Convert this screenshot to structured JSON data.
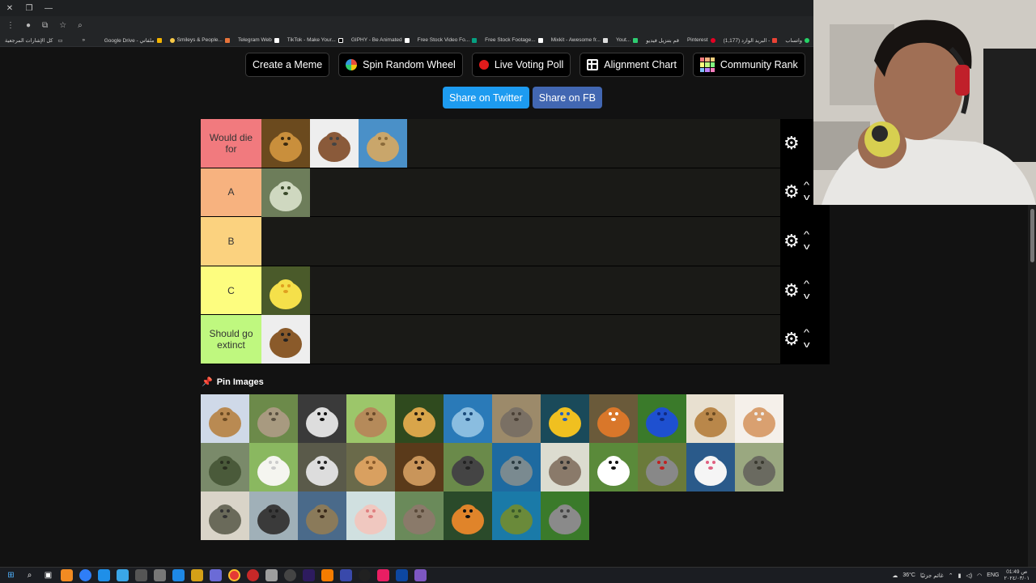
{
  "browser": {
    "bookmarks_left": "كل الإشارات المرجعية",
    "bookmarks": [
      "Google Drive - ملفاتي",
      "Smileys & People...",
      "Telegram Web",
      "TikTok - Make Your...",
      "GIPHY - Be Animated",
      "Free Stock Video Fo...",
      "Free Stock Footage...",
      "Mixkit - Awesome fr...",
      "Yout...",
      "قم بتنزيل فيديو",
      "Pinterest",
      "(1,177) البريد الوارد -",
      "واتساب"
    ],
    "overflow": "»"
  },
  "toolbar": {
    "create_meme": "Create a Meme",
    "spin_wheel": "Spin Random Wheel",
    "live_voting": "Live Voting Poll",
    "alignment_chart": "Alignment Chart",
    "community_rank": "Community Rank"
  },
  "share": {
    "twitter": "Share on Twitter",
    "facebook": "Share on FB"
  },
  "tiers": [
    {
      "label": "Would die for",
      "color": "#f17a7e",
      "items": [
        "lion",
        "horse",
        "camel"
      ]
    },
    {
      "label": "A",
      "color": "#f7b27f",
      "items": [
        "snake"
      ]
    },
    {
      "label": "B",
      "color": "#fbd27f",
      "items": []
    },
    {
      "label": "C",
      "color": "#fdfd7f",
      "items": [
        "duckling"
      ]
    },
    {
      "label": "Should go extinct",
      "color": "#bff87f",
      "items": [
        "beagle"
      ]
    }
  ],
  "pin_images": {
    "label": "Pin Images",
    "items": [
      "alpaca",
      "armadillo",
      "badger",
      "rabbit",
      "cheetah",
      "dolphin",
      "elephant",
      "tropical-fish",
      "fox",
      "poison-frog",
      "giraffes",
      "hamster",
      "iguana",
      "lamb",
      "lemur",
      "liger",
      "meerkats",
      "gorilla",
      "seal",
      "owl",
      "panda",
      "parrot",
      "white-rat",
      "rhino",
      "roadrunner",
      "sea-lion",
      "sloth",
      "axolotl",
      "monkey",
      "tiger",
      "sea-turtle",
      "wolf"
    ]
  },
  "taskbar": {
    "weather": "36°C",
    "weather_text": "غائم جزئيًا",
    "lang": "ENG",
    "time": "01:49 ص",
    "date": "٢٠٢٤/٠٣/٠١"
  }
}
